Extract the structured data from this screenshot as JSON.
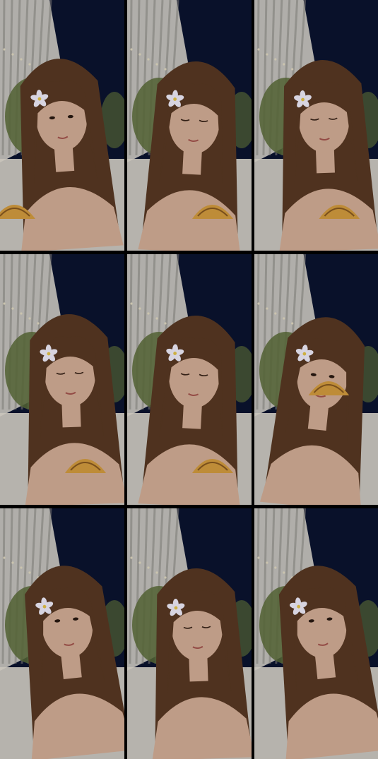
{
  "frames": [
    {
      "id": 1,
      "pose": "holding-food",
      "has_food": true,
      "flower": true
    },
    {
      "id": 2,
      "pose": "eyes-closed",
      "has_food": true,
      "flower": true
    },
    {
      "id": 3,
      "pose": "looking-down",
      "has_food": true,
      "flower": true
    },
    {
      "id": 4,
      "pose": "looking-down",
      "has_food": true,
      "flower": true
    },
    {
      "id": 5,
      "pose": "eyes-closed",
      "has_food": true,
      "flower": true
    },
    {
      "id": 6,
      "pose": "eating",
      "has_food": true,
      "flower": true
    },
    {
      "id": 7,
      "pose": "looking-up",
      "has_food": false,
      "flower": true
    },
    {
      "id": 8,
      "pose": "looking-down",
      "has_food": false,
      "flower": true
    },
    {
      "id": 9,
      "pose": "looking-up",
      "has_food": false,
      "flower": true
    }
  ],
  "colors": {
    "sky": "#0b1430",
    "building": "#c9c7c2",
    "building_stripe": "#8d8a86",
    "foliage": "#5d6e3a",
    "hair": "#5a3a24",
    "skin": "#d9b29a",
    "sofa": "#e6e0d6",
    "food": "#d9a040",
    "flower": "#f5f2ff"
  }
}
